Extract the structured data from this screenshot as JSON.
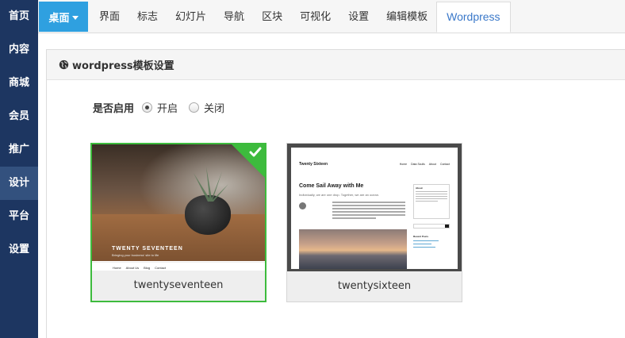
{
  "sidebar": {
    "items": [
      {
        "label": "首页"
      },
      {
        "label": "内容"
      },
      {
        "label": "商城"
      },
      {
        "label": "会员"
      },
      {
        "label": "推广"
      },
      {
        "label": "设计",
        "active": true
      },
      {
        "label": "平台"
      },
      {
        "label": "设置"
      }
    ]
  },
  "topbar": {
    "desktop_label": "桌面",
    "tabs": [
      {
        "label": "界面"
      },
      {
        "label": "标志"
      },
      {
        "label": "幻灯片"
      },
      {
        "label": "导航"
      },
      {
        "label": "区块"
      },
      {
        "label": "可视化"
      },
      {
        "label": "设置"
      },
      {
        "label": "编辑模板"
      },
      {
        "label": "Wordpress",
        "active": true
      }
    ]
  },
  "panel": {
    "title": "wordpress模板设置",
    "enable_label": "是否启用",
    "options": [
      {
        "label": "开启",
        "checked": true
      },
      {
        "label": "关闭",
        "checked": false
      }
    ]
  },
  "themes": [
    {
      "name": "twentyseventeen",
      "selected": true,
      "preview": {
        "title": "TWENTY SEVENTEEN",
        "subtitle": "Bringing your business' site to life",
        "nav": [
          "Home",
          "About Us",
          "Blog",
          "Contact"
        ]
      }
    },
    {
      "name": "twentysixteen",
      "selected": false,
      "preview": {
        "brand": "Twenty Sixteen",
        "nav": [
          "Home",
          "Data Sculls",
          "About",
          "Contact"
        ],
        "post_title": "Come Sail Away with Me",
        "excerpt": "Individually, we are one drop. Together, we are an ocean.",
        "sidebar_heading": "About",
        "recent_heading": "Recent Posts"
      }
    }
  ],
  "colors": {
    "sidebar_bg": "#1d3661",
    "accent_blue": "#2fa0e0",
    "selected_green": "#3dbb3d"
  }
}
